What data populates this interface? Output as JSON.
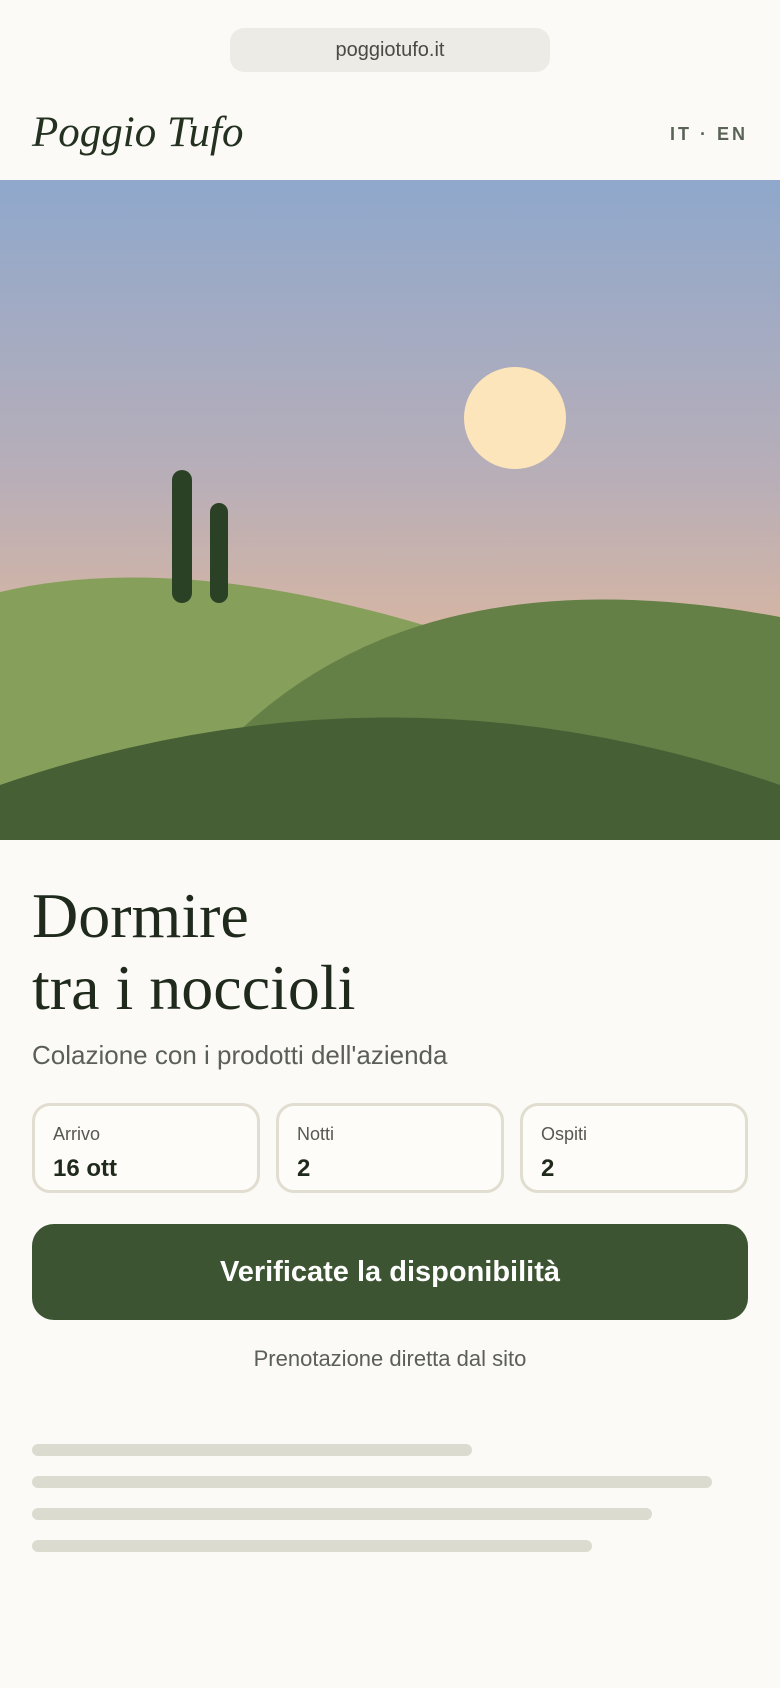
{
  "browser": {
    "url": "poggiotufo.it"
  },
  "header": {
    "brand": "Poggio Tufo",
    "lang_it": "IT",
    "lang_sep": "·",
    "lang_en": "EN"
  },
  "hero": {
    "colors": {
      "sky_top": "#8fa8cc",
      "sky_mid": "#b8aeb8",
      "sky_bottom": "#e4b999",
      "sun": "#fde5bb",
      "hill_back": "#86a05c",
      "hill_mid": "#648046",
      "hill_front": "#465f34",
      "cypress": "#2b4126"
    }
  },
  "main": {
    "headline_line1": "Dormire",
    "headline_line2": "tra i noccioli",
    "subtitle": "Colazione con i prodotti dell'azienda",
    "fields": [
      {
        "label": "Arrivo",
        "value": "16 ott"
      },
      {
        "label": "Notti",
        "value": "2"
      },
      {
        "label": "Ospiti",
        "value": "2"
      }
    ],
    "cta_label": "Verificate la disponibilità",
    "note": "Prenotazione diretta dal sito"
  },
  "colors": {
    "accent": "#3c5432",
    "background": "#fbfaf6",
    "placeholder": "#dcdbcf"
  }
}
